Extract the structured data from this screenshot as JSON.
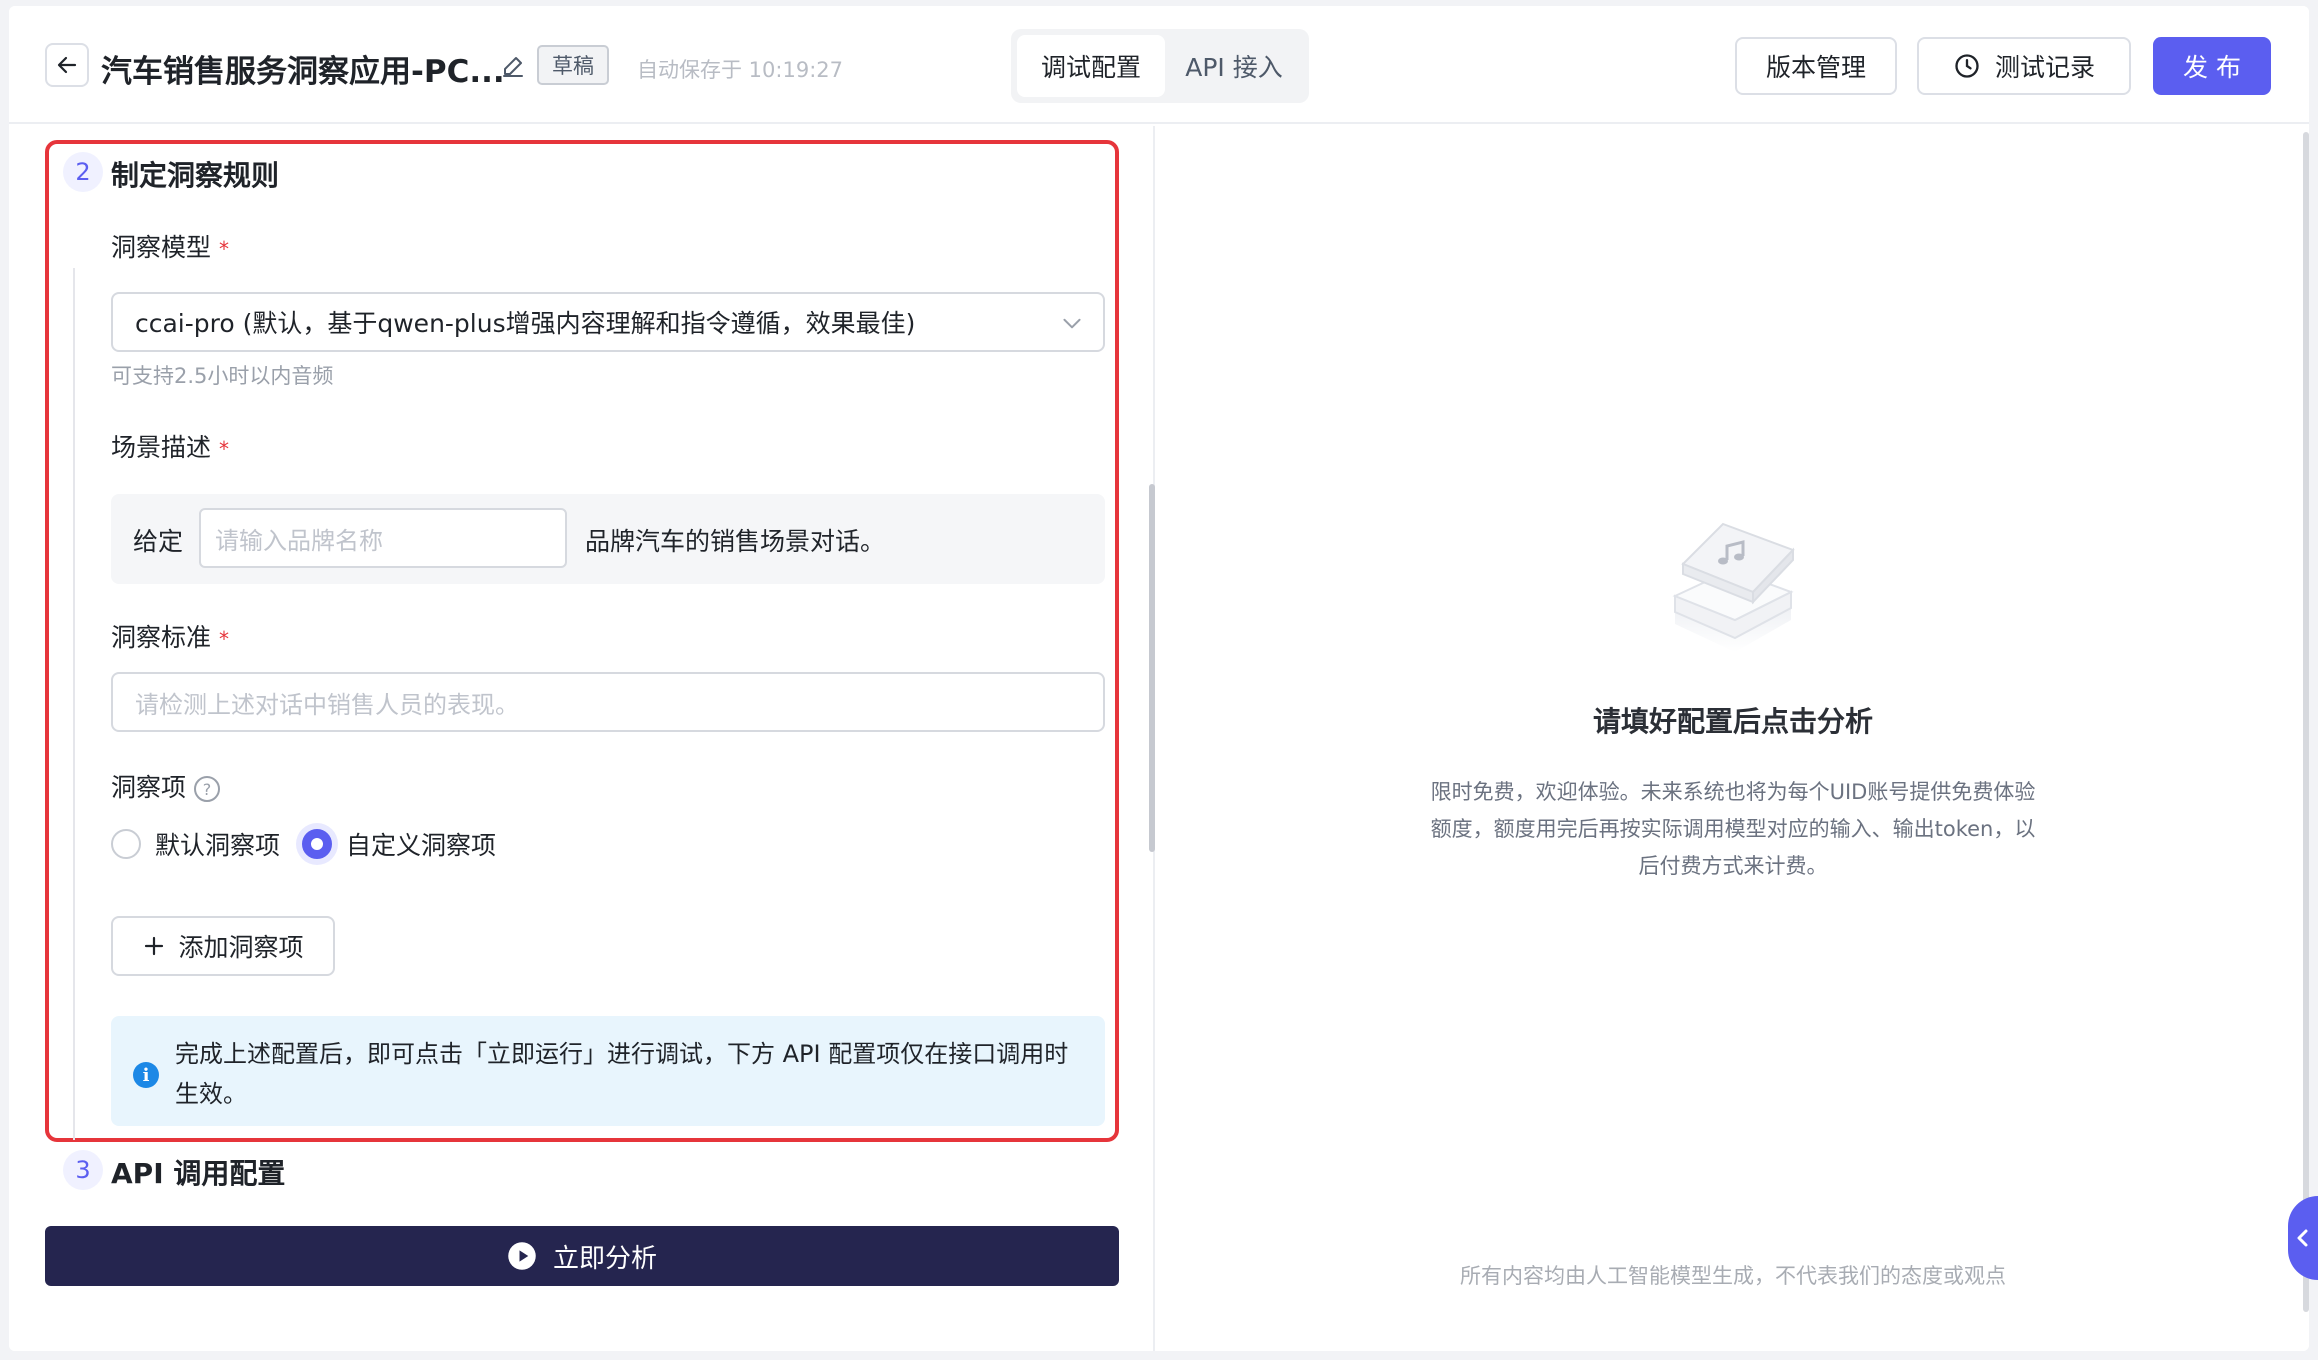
{
  "header": {
    "app_title": "汽车销售服务洞察应用-PC...",
    "draft_badge": "草稿",
    "autosave": "自动保存于 10:19:27",
    "tabs": [
      {
        "label": "调试配置",
        "active": true
      },
      {
        "label": "API 接入",
        "active": false
      }
    ],
    "version_button": "版本管理",
    "history_button": "测试记录",
    "publish_button": "发 布"
  },
  "config": {
    "section2": {
      "number": "2",
      "title": "制定洞察规则"
    },
    "model": {
      "label": "洞察模型",
      "required_mark": "*",
      "selected": "ccai-pro (默认，基于qwen-plus增强内容理解和指令遵循，效果最佳)",
      "hint": "可支持2.5小时以内音频"
    },
    "scene": {
      "label": "场景描述",
      "required_mark": "*",
      "prefix": "给定",
      "placeholder": "请输入品牌名称",
      "suffix": "品牌汽车的销售场景对话。"
    },
    "standard": {
      "label": "洞察标准",
      "required_mark": "*",
      "placeholder": "请检测上述对话中销售人员的表现。"
    },
    "items": {
      "label": "洞察项",
      "help_mark": "?",
      "options": [
        {
          "label": "默认洞察项",
          "checked": false
        },
        {
          "label": "自定义洞察项",
          "checked": true
        }
      ],
      "add_button": "添加洞察项"
    },
    "info_icon": "i",
    "info_text": "完成上述配置后，即可点击「立即运行」进行调试，下方 API 配置项仅在接口调用时生效。",
    "section3": {
      "number": "3",
      "title": "API 调用配置"
    },
    "run_button": "立即分析"
  },
  "preview": {
    "empty_title": "请填好配置后点击分析",
    "empty_desc": "限时免费，欢迎体验。未来系统也将为每个UID账号提供免费体验额度，额度用完后再按实际调用模型对应的输入、输出token，以后付费方式来计费。",
    "disclaimer": "所有内容均由人工智能模型生成，不代表我们的态度或观点"
  },
  "colors": {
    "accent": "#5b5ef0",
    "highlight_border": "#e6353b",
    "run_button_bg": "#25254f",
    "info_bg": "#e8f5fd",
    "info_icon": "#1c88e6"
  }
}
